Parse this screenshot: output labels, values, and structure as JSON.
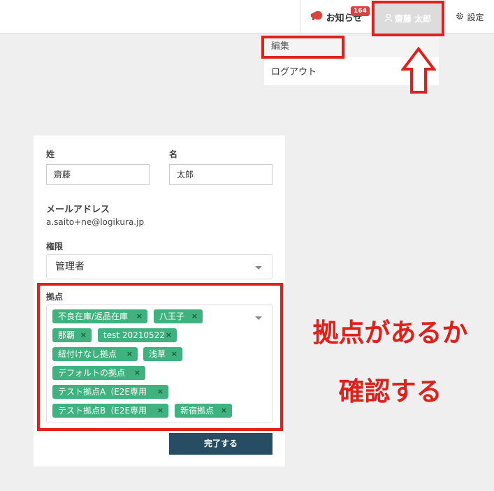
{
  "header": {
    "notice_label": "お知らせ",
    "notice_count": "164",
    "user_name": "齋藤 太郎",
    "settings_label": "設定"
  },
  "dropdown": {
    "edit_label": "編集",
    "logout_label": "ログアウト"
  },
  "form": {
    "last_name_label": "姓",
    "last_name_value": "齋藤",
    "first_name_label": "名",
    "first_name_value": "太郎",
    "email_label": "メールアドレス",
    "email_value": "a.saito+ne@logikura.jp",
    "role_label": "権限",
    "role_value": "管理者",
    "location_label": "拠点",
    "locations": [
      "不良在庫/返品在庫",
      "八王子",
      "那覇",
      "test 20210522",
      "紐付けなし拠点",
      "浅草",
      "デフォルトの拠点",
      "テスト拠点A（E2E専用",
      "テスト拠点B（E2E専用",
      "新宿拠点"
    ],
    "submit_label": "完了する"
  },
  "annotation": {
    "line1": "拠点があるか",
    "line2": "確認する"
  },
  "colors": {
    "accent_red": "#e0201b",
    "tag_green": "#3fb27f",
    "button_navy": "#264d63"
  }
}
